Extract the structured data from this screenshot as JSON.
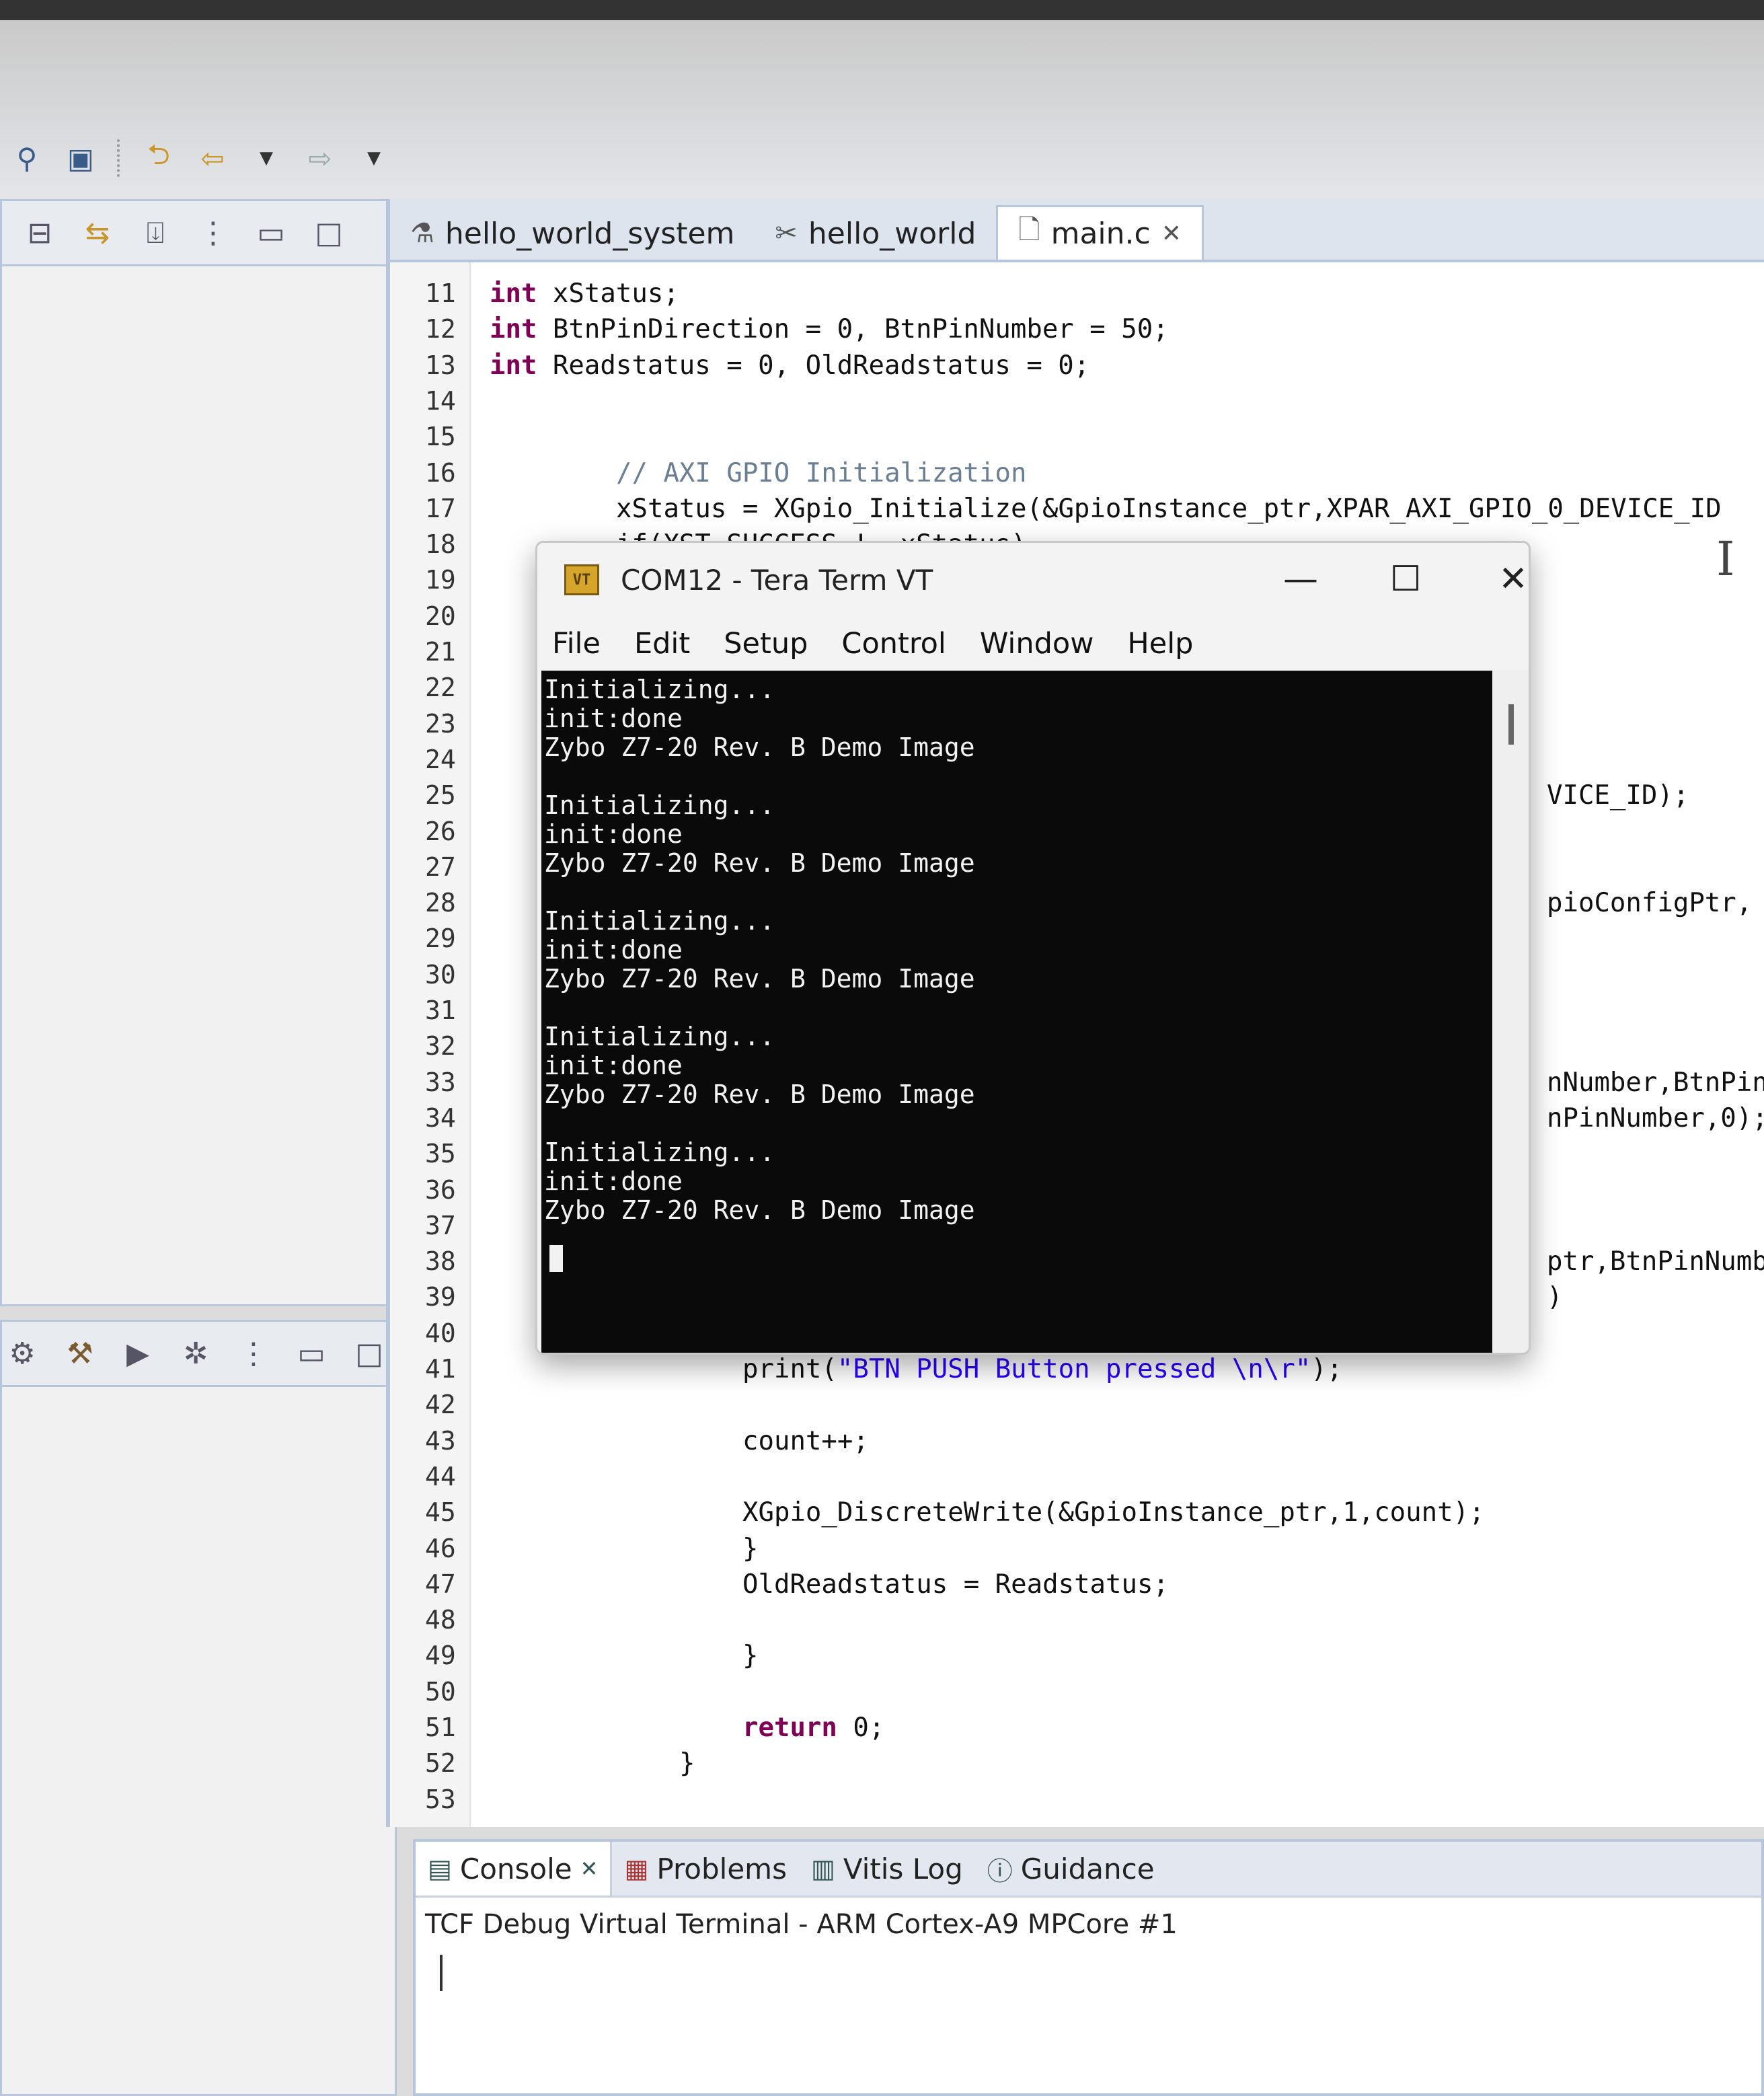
{
  "toolbar": {
    "icons": [
      "plug-icon",
      "terminal-icon",
      "back-history-icon",
      "back-arrow-icon",
      "dropdown-icon",
      "forward-arrow-icon",
      "dropdown-icon"
    ]
  },
  "editor": {
    "tabs": [
      {
        "label": "hello_world_system",
        "icon": "system-flask-icon",
        "active": false
      },
      {
        "label": "hello_world",
        "icon": "app-tools-icon",
        "active": false
      },
      {
        "label": "main.c",
        "icon": "c-file-icon",
        "active": true
      }
    ],
    "lines": [
      {
        "no": "11",
        "code": "int xStatus;",
        "indent": 0
      },
      {
        "no": "12",
        "code": "int BtnPinDirection = 0, BtnPinNumber = 50;",
        "indent": 0
      },
      {
        "no": "13",
        "code": "int Readstatus = 0, OldReadstatus = 0;",
        "indent": 0
      },
      {
        "no": "14",
        "code": "",
        "indent": 0
      },
      {
        "no": "15",
        "code": "",
        "indent": 0
      },
      {
        "no": "16",
        "code": "// AXI GPIO Initialization",
        "indent": 2
      },
      {
        "no": "17",
        "code": "xStatus = XGpio_Initialize(&GpioInstance_ptr,XPAR_AXI_GPIO_0_DEVICE_ID",
        "indent": 2
      },
      {
        "no": "18",
        "code": "if(XST_SUCCESS != xStatus)",
        "indent": 2
      },
      {
        "no": "19",
        "code": "",
        "indent": 0
      },
      {
        "no": "20",
        "code": "",
        "indent": 0
      },
      {
        "no": "21",
        "code": "",
        "indent": 0
      },
      {
        "no": "22",
        "code": "",
        "indent": 0
      },
      {
        "no": "23",
        "code": "",
        "indent": 0
      },
      {
        "no": "24",
        "code": "",
        "indent": 0
      },
      {
        "no": "25",
        "code": "VICE_ID);",
        "indent": 0
      },
      {
        "no": "26",
        "code": "",
        "indent": 0
      },
      {
        "no": "27",
        "code": "",
        "indent": 0
      },
      {
        "no": "28",
        "code": "pioConfigPtr, G",
        "indent": 0
      },
      {
        "no": "29",
        "code": "",
        "indent": 0
      },
      {
        "no": "30",
        "code": "",
        "indent": 0
      },
      {
        "no": "31",
        "code": "",
        "indent": 0
      },
      {
        "no": "32",
        "code": "",
        "indent": 0
      },
      {
        "no": "33",
        "code": "nNumber,BtnPinD",
        "indent": 0
      },
      {
        "no": "34",
        "code": "nPinNumber,0);",
        "indent": 0
      },
      {
        "no": "35",
        "code": "",
        "indent": 0
      },
      {
        "no": "36",
        "code": "",
        "indent": 0
      },
      {
        "no": "37",
        "code": "",
        "indent": 0
      },
      {
        "no": "38",
        "code": "ptr,BtnPinNumbe",
        "indent": 0
      },
      {
        "no": "39",
        "code": ")",
        "indent": 0
      },
      {
        "no": "40",
        "code": "",
        "indent": 0
      },
      {
        "no": "41",
        "code": "print(\"BTN PUSH Button pressed \\n\\r\");",
        "indent": 4
      },
      {
        "no": "42",
        "code": "",
        "indent": 0
      },
      {
        "no": "43",
        "code": "count++;",
        "indent": 4
      },
      {
        "no": "44",
        "code": "",
        "indent": 0
      },
      {
        "no": "45",
        "code": "XGpio_DiscreteWrite(&GpioInstance_ptr,1,count);",
        "indent": 4
      },
      {
        "no": "46",
        "code": "}",
        "indent": 4
      },
      {
        "no": "47",
        "code": "OldReadstatus = Readstatus;",
        "indent": 4
      },
      {
        "no": "48",
        "code": "",
        "indent": 0
      },
      {
        "no": "49",
        "code": "}",
        "indent": 4
      },
      {
        "no": "50",
        "code": "",
        "indent": 0
      },
      {
        "no": "51",
        "code": "return 0;",
        "indent": 4
      },
      {
        "no": "52",
        "code": "}",
        "indent": 3
      },
      {
        "no": "53",
        "code": "",
        "indent": 0
      }
    ]
  },
  "left_panes": {
    "top_icons": [
      "collapse-all-icon",
      "link-editor-icon",
      "import-icon",
      "view-menu-icon",
      "minimize-icon",
      "maximize-icon"
    ],
    "bottom_icons": [
      "gear-icon",
      "hammer-icon",
      "run-icon",
      "debug-bug-icon",
      "view-menu-icon",
      "minimize-icon",
      "maximize-icon"
    ]
  },
  "teraterm": {
    "title": "COM12 - Tera Term VT",
    "icon_text": "VT",
    "minimize": "—",
    "maximize": "☐",
    "close": "✕",
    "menu": [
      "File",
      "Edit",
      "Setup",
      "Control",
      "Window",
      "Help"
    ],
    "lines": [
      "Initializing...",
      "init:done",
      "Zybo Z7-20 Rev. B Demo Image",
      "",
      "Initializing...",
      "init:done",
      "Zybo Z7-20 Rev. B Demo Image",
      "",
      "Initializing...",
      "init:done",
      "Zybo Z7-20 Rev. B Demo Image",
      "",
      "Initializing...",
      "init:done",
      "Zybo Z7-20 Rev. B Demo Image",
      "",
      "Initializing...",
      "init:done",
      "Zybo Z7-20 Rev. B Demo Image"
    ]
  },
  "console": {
    "tabs": [
      {
        "label": "Console",
        "icon": "console-icon",
        "active": true
      },
      {
        "label": "Problems",
        "icon": "problems-icon",
        "active": false
      },
      {
        "label": "Vitis Log",
        "icon": "log-icon",
        "active": false
      },
      {
        "label": "Guidance",
        "icon": "info-icon",
        "active": false
      }
    ],
    "title": "TCF Debug Virtual Terminal - ARM Cortex-A9 MPCore #1"
  }
}
